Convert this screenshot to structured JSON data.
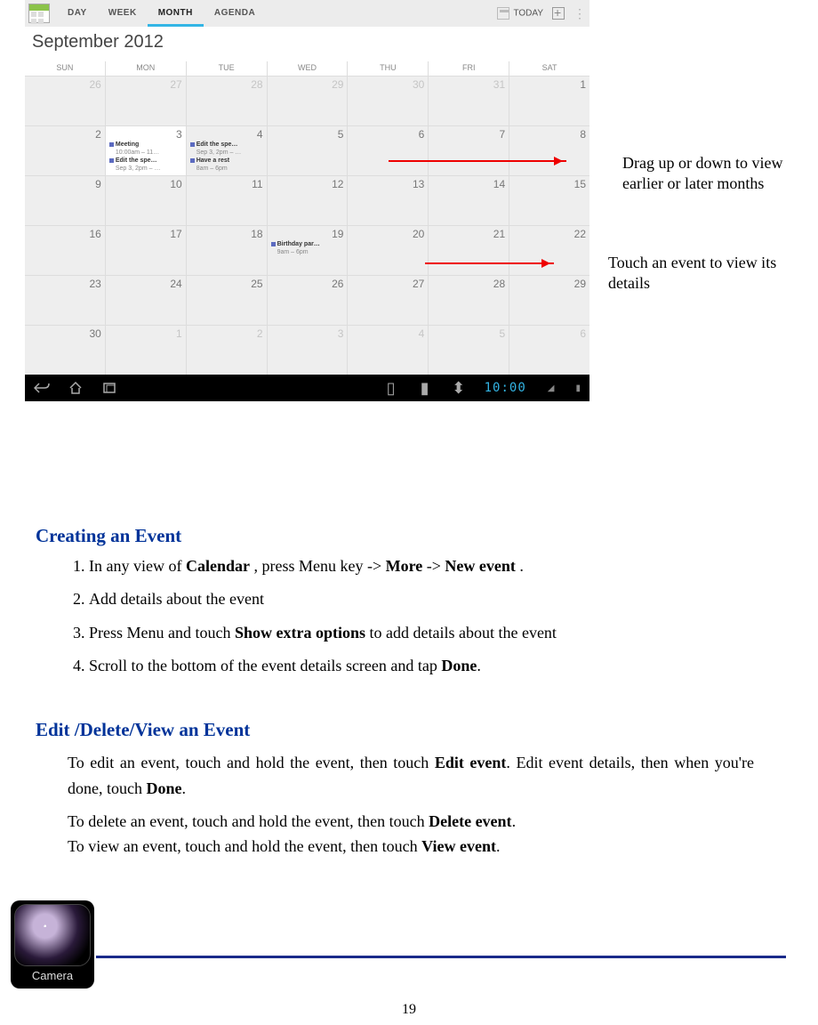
{
  "screenshot": {
    "tabs": [
      "DAY",
      "WEEK",
      "MONTH",
      "AGENDA"
    ],
    "active_tab_index": 2,
    "today_label": "TODAY",
    "month_label": "September 2012",
    "dows": [
      "SUN",
      "MON",
      "TUE",
      "WED",
      "THU",
      "FRI",
      "SAT"
    ],
    "weeks": [
      [
        {
          "n": "26",
          "out": true
        },
        {
          "n": "27",
          "out": true
        },
        {
          "n": "28",
          "out": true
        },
        {
          "n": "29",
          "out": true
        },
        {
          "n": "30",
          "out": true
        },
        {
          "n": "31",
          "out": true
        },
        {
          "n": "1"
        }
      ],
      [
        {
          "n": "2"
        },
        {
          "n": "3",
          "cur": true,
          "events": [
            {
              "title": "Meeting",
              "sub": "10:00am – 11…"
            },
            {
              "title": "Edit the spe…",
              "sub": "Sep 3, 2pm – …"
            }
          ]
        },
        {
          "n": "4",
          "events": [
            {
              "title": "Edit the spe…",
              "sub": "Sep 3, 2pm – …"
            },
            {
              "title": "Have a rest",
              "sub": "8am – 6pm"
            }
          ]
        },
        {
          "n": "5"
        },
        {
          "n": "6"
        },
        {
          "n": "7"
        },
        {
          "n": "8"
        }
      ],
      [
        {
          "n": "9"
        },
        {
          "n": "10"
        },
        {
          "n": "11"
        },
        {
          "n": "12"
        },
        {
          "n": "13"
        },
        {
          "n": "14"
        },
        {
          "n": "15"
        }
      ],
      [
        {
          "n": "16"
        },
        {
          "n": "17"
        },
        {
          "n": "18"
        },
        {
          "n": "19",
          "events": [
            {
              "title": "Birthday par…",
              "sub": "9am – 6pm"
            }
          ]
        },
        {
          "n": "20"
        },
        {
          "n": "21"
        },
        {
          "n": "22"
        }
      ],
      [
        {
          "n": "23"
        },
        {
          "n": "24"
        },
        {
          "n": "25"
        },
        {
          "n": "26"
        },
        {
          "n": "27"
        },
        {
          "n": "28"
        },
        {
          "n": "29"
        }
      ],
      [
        {
          "n": "30"
        },
        {
          "n": "1",
          "out": true
        },
        {
          "n": "2",
          "out": true
        },
        {
          "n": "3",
          "out": true
        },
        {
          "n": "4",
          "out": true
        },
        {
          "n": "5",
          "out": true
        },
        {
          "n": "6",
          "out": true
        }
      ]
    ],
    "clock": "10:00",
    "icons": {
      "back": "⤺",
      "home": "⌂",
      "recent": "▭"
    }
  },
  "annotations": {
    "drag": "Drag up or down to view earlier or later months",
    "touch": "Touch an event to view its details"
  },
  "sections": {
    "create": {
      "heading": "Creating an Event",
      "steps": [
        {
          "pre": "In any view of ",
          "b1": "Calendar",
          "mid": " , press Menu key -> ",
          "b2": "More",
          "mid2": " -> ",
          "b3": "New event",
          "post": " ."
        },
        {
          "plain": "Add details about the event"
        },
        {
          "pre": "Press Menu and touch ",
          "b1": "Show extra options",
          "post": " to add details about the event"
        },
        {
          "pre": "Scroll to the bottom of the event details screen and tap ",
          "b1": "Done",
          "post": "."
        }
      ]
    },
    "edit": {
      "heading": "Edit /Delete/View an Event",
      "p1_a": "To edit an event, touch and hold the event, then touch ",
      "p1_b": "Edit event",
      "p1_c": ". Edit event details, then when you're done, touch ",
      "p1_d": "Done",
      "p1_e": ".",
      "p2_a": "To delete an event, touch and hold the event, then touch ",
      "p2_b": "Delete event",
      "p2_c": ".",
      "p3_a": "To view an event, touch and hold the event, then touch ",
      "p3_b": "View event",
      "p3_c": "."
    }
  },
  "camera_label": "Camera",
  "page_number": "19"
}
